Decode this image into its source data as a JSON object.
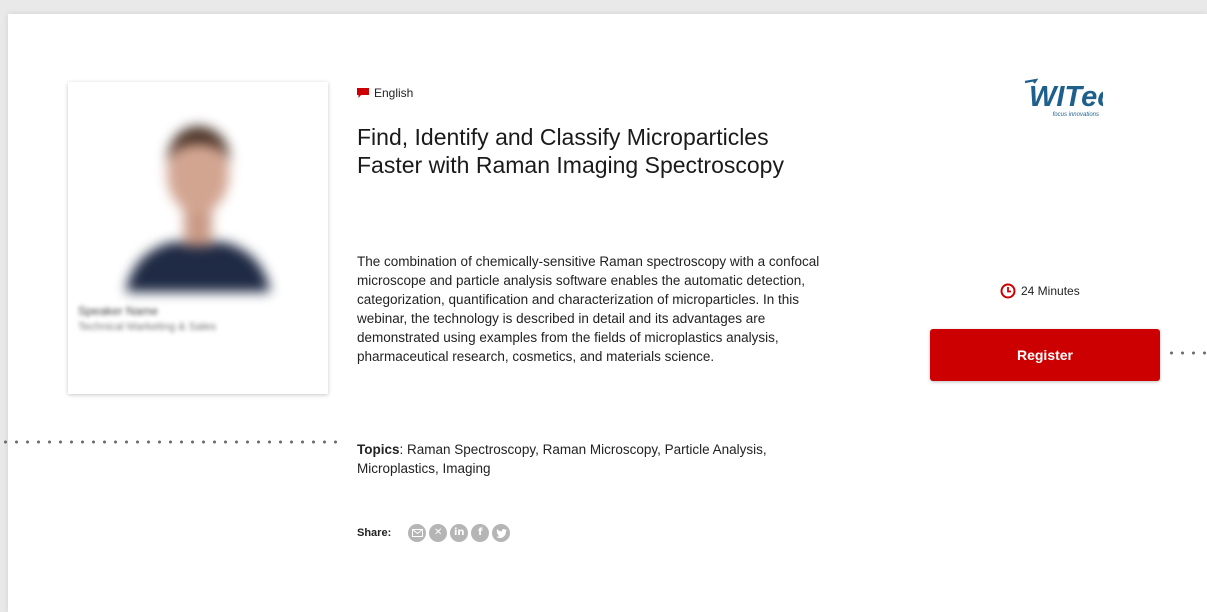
{
  "webinar": {
    "language": "English",
    "title": "Find, Identify and Classify Microparticles Faster with Raman Imaging Spectroscopy",
    "description": "The combination of chemically-sensitive Raman spectroscopy with a confocal microscope and particle analysis software enables the automatic detection, categorization, quantification and characterization of microparticles. In this webinar, the technology is described in detail and its advantages are demonstrated using examples from the fields of microplastics analysis, pharmaceutical research, cosmetics, and materials science.",
    "topics_label": "Topics",
    "topics": ": Raman Spectroscopy, Raman Microscopy, Particle Analysis, Microplastics, Imaging"
  },
  "speaker": {
    "name": "Speaker Name",
    "role": "Technical Marketing & Sales"
  },
  "sidebar": {
    "logo_text": "WITec",
    "logo_tagline": "focus innovations",
    "duration": "24 Minutes",
    "register_label": "Register"
  },
  "share": {
    "label": "Share:",
    "icons": [
      "email-icon",
      "xing-icon",
      "linkedin-icon",
      "facebook-icon",
      "twitter-icon"
    ]
  },
  "colors": {
    "accent": "#cc0000",
    "logo": "#1e5f8c",
    "share_icon": "#b5b5b5"
  }
}
